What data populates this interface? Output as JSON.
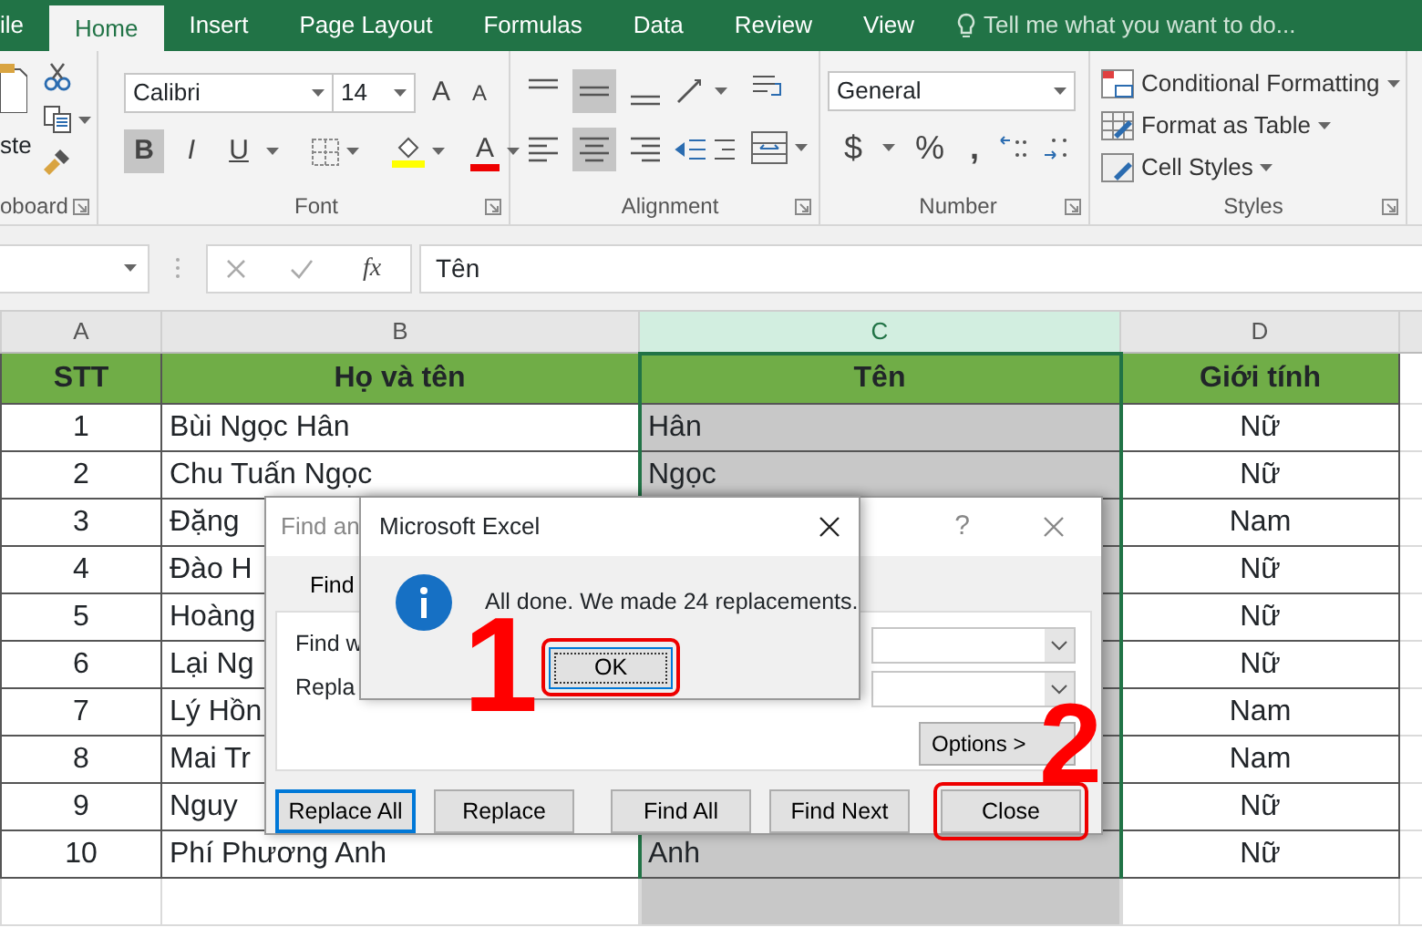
{
  "ribbon_tabs": [
    {
      "label": "ile",
      "selected": false
    },
    {
      "label": "Home",
      "selected": true
    },
    {
      "label": "Insert",
      "selected": false
    },
    {
      "label": "Page Layout",
      "selected": false
    },
    {
      "label": "Formulas",
      "selected": false
    },
    {
      "label": "Data",
      "selected": false
    },
    {
      "label": "Review",
      "selected": false
    },
    {
      "label": "View",
      "selected": false
    }
  ],
  "tell_me": "Tell me what you want to do...",
  "ribbon": {
    "clipboard": {
      "paste_label": "ste",
      "group": "oboard"
    },
    "font": {
      "font_name": "Calibri",
      "font_size": "14",
      "grow": "A",
      "shrink": "A",
      "toggles": [
        {
          "kind": "bold",
          "label": "B",
          "pressed": true
        },
        {
          "kind": "italic",
          "label": "I",
          "pressed": false
        },
        {
          "kind": "underline",
          "label": "U",
          "pressed": false
        }
      ],
      "font_color": "A",
      "group": "Font"
    },
    "alignment": {
      "vertical": [
        {
          "kind": "top",
          "pressed": false
        },
        {
          "kind": "middle",
          "pressed": true
        },
        {
          "kind": "bottom",
          "pressed": false
        }
      ],
      "horizontal": [
        {
          "kind": "left",
          "pressed": false
        },
        {
          "kind": "center",
          "pressed": true
        },
        {
          "kind": "right",
          "pressed": false
        }
      ],
      "group": "Alignment"
    },
    "number": {
      "format": "General",
      "currency": "$",
      "percent": "%",
      "comma": ",",
      "group": "Number"
    },
    "styles": {
      "items": [
        "Conditional Formatting",
        "Format as Table",
        "Cell Styles"
      ],
      "group": "Styles"
    }
  },
  "formula_bar": {
    "fx": "fx",
    "value": "Tên"
  },
  "sheet": {
    "columns": [
      {
        "label": "A",
        "selected": false
      },
      {
        "label": "B",
        "selected": false
      },
      {
        "label": "C",
        "selected": true
      },
      {
        "label": "D",
        "selected": false
      }
    ],
    "header": [
      "STT",
      "Họ và tên",
      "Tên",
      "Giới tính"
    ],
    "rows": [
      {
        "stt": "1",
        "name": "Bùi Ngọc Hân",
        "short_name": "Hân",
        "gender": "Nữ"
      },
      {
        "stt": "2",
        "name": "Chu Tuấn Ngọc",
        "short_name": "Ngọc",
        "gender": "Nữ"
      },
      {
        "stt": "3",
        "name": "Đặng",
        "gender": "Nam"
      },
      {
        "stt": "4",
        "name": "Đào H",
        "gender": "Nữ"
      },
      {
        "stt": "5",
        "name": "Hoàng",
        "gender": "Nữ"
      },
      {
        "stt": "6",
        "name": "Lại Ng",
        "gender": "Nữ"
      },
      {
        "stt": "7",
        "name": "Lý Hồn",
        "gender": "Nam"
      },
      {
        "stt": "8",
        "name": "Mai Tr",
        "gender": "Nam"
      },
      {
        "stt": "9",
        "name": "Nguy",
        "gender": "Nữ"
      },
      {
        "stt": "10",
        "name": "Phí Phương Anh",
        "short_name": "Anh",
        "gender": "Nữ"
      }
    ]
  },
  "find_replace": {
    "title": "Find an",
    "help": "?",
    "tabs": [
      {
        "label": "Find",
        "selected": false
      }
    ],
    "find_label": "Find w",
    "replace_label": "Repla",
    "options_button": "Options >",
    "buttons": [
      {
        "label": "Replace All",
        "focused": true,
        "annotated": false
      },
      {
        "label": "Replace",
        "focused": false,
        "annotated": false
      },
      {
        "label": "Find All",
        "focused": false,
        "annotated": false
      },
      {
        "label": "Find Next",
        "focused": false,
        "annotated": false
      },
      {
        "label": "Close",
        "focused": false,
        "annotated": true
      }
    ]
  },
  "message_box": {
    "title": "Microsoft Excel",
    "message": "All done. We made 24 replacements.",
    "ok_button": {
      "label": "OK",
      "annotated": true
    }
  },
  "annotations": [
    "1",
    "2"
  ]
}
